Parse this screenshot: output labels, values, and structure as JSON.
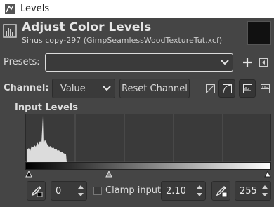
{
  "window": {
    "title": "Levels"
  },
  "header": {
    "title": "Adjust Color Levels",
    "subtitle": "Sinus copy-297 (GimpSeamlessWoodTextureTut.xcf)"
  },
  "presets": {
    "label": "Presets:",
    "value": ""
  },
  "channel": {
    "label": "Channel:",
    "value": "Value",
    "reset_label": "Reset Channel"
  },
  "input_levels": {
    "title": "Input Levels",
    "black_point": "0",
    "gamma": "2.10",
    "white_point": "255",
    "clamp_label": "Clamp input",
    "clamp_checked": false
  },
  "icons": {
    "window_icon": "gimp-icon",
    "header_icon": "levels-icon",
    "add_preset": "plus-icon",
    "preset_menu": "menu-arrow-icon",
    "linear_histogram": "linear-histogram-icon",
    "log_histogram": "log-histogram-icon",
    "picker_black": "eyedropper-black-icon",
    "picker_white": "eyedropper-white-icon"
  }
}
